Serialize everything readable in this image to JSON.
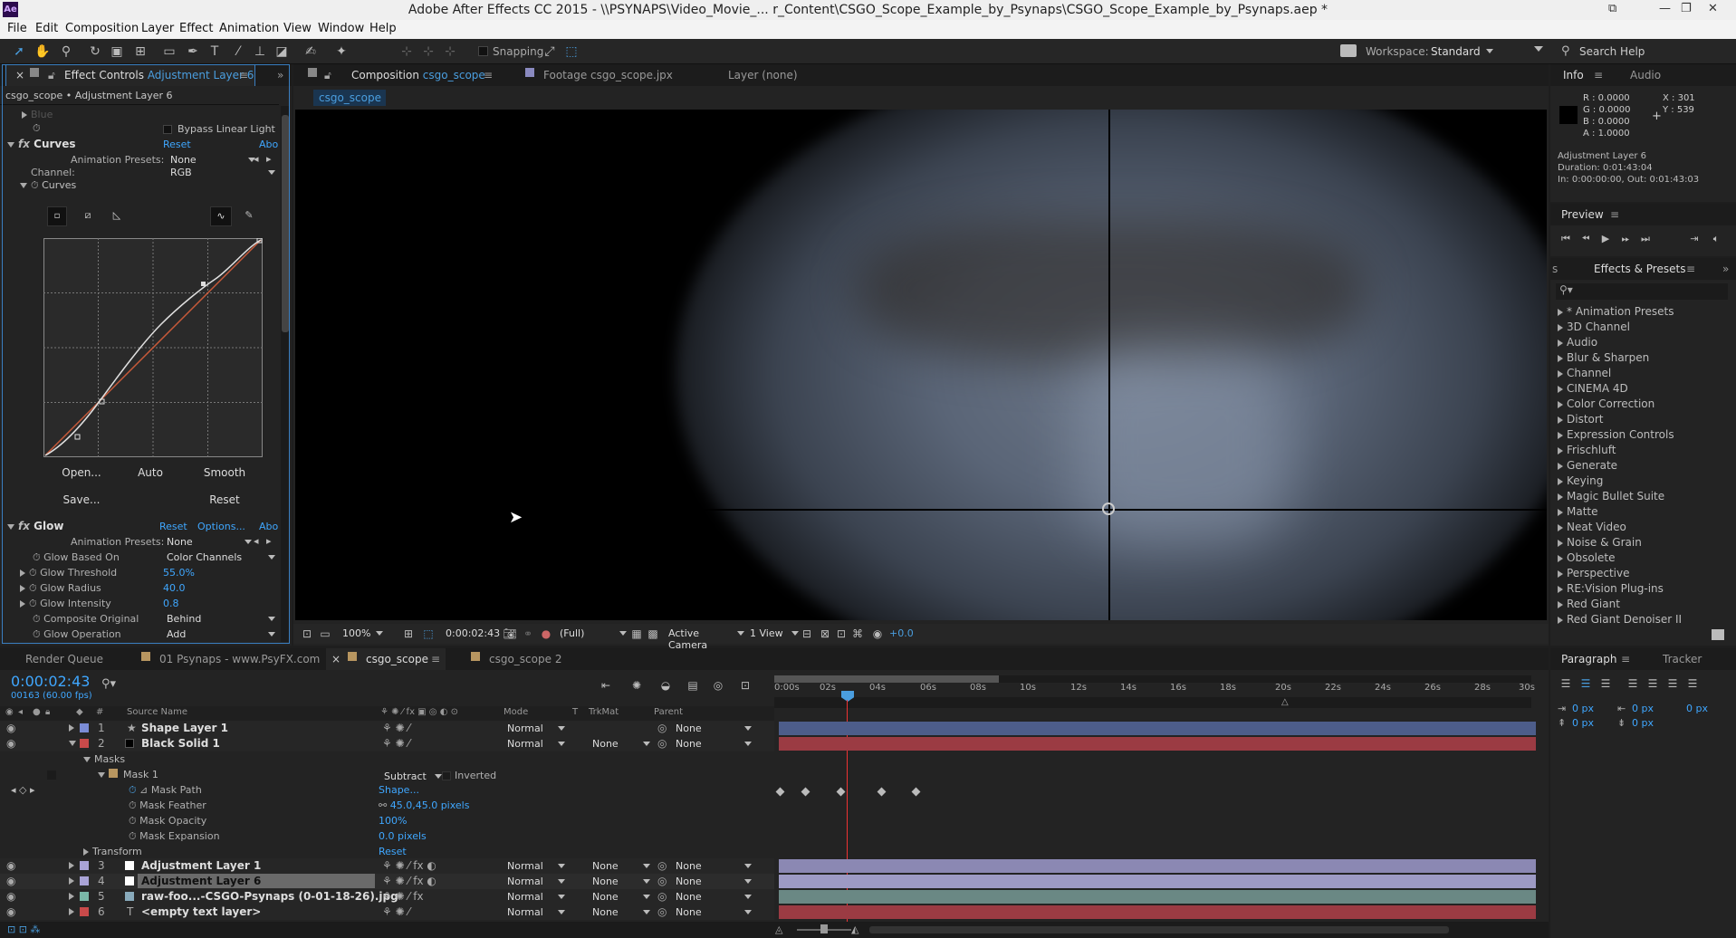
{
  "app": {
    "title": "Adobe After Effects CC 2015 - \\\\PSYNAPS\\Video_Movie_... r_Content\\CSGO_Scope_Example_by_Psynaps\\CSGO_Scope_Example_by_Psynaps.aep *",
    "logo": "Ae"
  },
  "menu": [
    "File",
    "Edit",
    "Composition",
    "Layer",
    "Effect",
    "Animation",
    "View",
    "Window",
    "Help"
  ],
  "toolbar": {
    "snapping": "Snapping",
    "workspace_label": "Workspace:",
    "workspace_value": "Standard",
    "search": "Search Help"
  },
  "effect_controls": {
    "tab_prefix": "Effect Controls",
    "tab_layer": "Adjustment Layer 6",
    "header": "csgo_scope • Adjustment Layer 6",
    "blue_row": "Blue",
    "bypass": "Bypass Linear Light",
    "curves": {
      "name": "Curves",
      "reset": "Reset",
      "about": "Abo",
      "anim_label": "Animation Presets:",
      "anim_value": "None",
      "channel_label": "Channel:",
      "channel_value": "RGB",
      "curves_label": "Curves",
      "btn_open": "Open...",
      "btn_auto": "Auto",
      "btn_smooth": "Smooth",
      "btn_save": "Save...",
      "btn_reset": "Reset"
    },
    "glow": {
      "name": "Glow",
      "reset": "Reset",
      "options": "Options...",
      "about": "Abo",
      "anim_label": "Animation Presets:",
      "anim_value": "None",
      "based_label": "Glow Based On",
      "based_value": "Color Channels",
      "threshold_label": "Glow Threshold",
      "threshold_value": "55.0%",
      "radius_label": "Glow Radius",
      "radius_value": "40.0",
      "intensity_label": "Glow Intensity",
      "intensity_value": "0.8",
      "composite_label": "Composite Original",
      "composite_value": "Behind",
      "operation_label": "Glow Operation",
      "operation_value": "Add"
    }
  },
  "composition": {
    "tab_prefix": "Composition",
    "tab_name": "csgo_scope",
    "footage_tab": "Footage csgo_scope.jpx",
    "layer_tab": "Layer (none)",
    "subtab": "csgo_scope",
    "zoom": "100%",
    "timecode": "0:00:02:43",
    "resolution": "(Full)",
    "camera": "Active Camera",
    "views": "1 View",
    "exposure": "+0.0"
  },
  "info": {
    "tab_info": "Info",
    "tab_audio": "Audio",
    "r": "R : 0.0000",
    "g": "G : 0.0000",
    "b": "B : 0.0000",
    "a": "A : 1.0000",
    "x": "X : 301",
    "y": "Y : 539",
    "layer_name": "Adjustment Layer 6",
    "duration": "Duration: 0:01:43:04",
    "inout": "In: 0:00:00:00, Out: 0:01:43:03"
  },
  "preview": {
    "title": "Preview"
  },
  "effects_presets": {
    "tab": "Effects & Presets",
    "items": [
      "* Animation Presets",
      "3D Channel",
      "Audio",
      "Blur & Sharpen",
      "Channel",
      "CINEMA 4D",
      "Color Correction",
      "Distort",
      "Expression Controls",
      "Frischluft",
      "Generate",
      "Keying",
      "Magic Bullet Suite",
      "Matte",
      "Neat Video",
      "Noise & Grain",
      "Obsolete",
      "Perspective",
      "RE:Vision Plug-ins",
      "Red Giant",
      "Red Giant Denoiser II"
    ]
  },
  "timeline": {
    "tabs": [
      "Render Queue",
      "01 Psynaps - www.PsyFX.com",
      "csgo_scope",
      "csgo_scope 2"
    ],
    "timecode": "0:00:02:43",
    "frames": "00163 (60.00 fps)",
    "columns": {
      "num": "#",
      "source": "Source Name",
      "mode": "Mode",
      "t": "T",
      "trkmat": "TrkMat",
      "parent": "Parent"
    },
    "ruler": [
      "0:00s",
      "02s",
      "04s",
      "06s",
      "08s",
      "10s",
      "12s",
      "14s",
      "16s",
      "18s",
      "20s",
      "22s",
      "24s",
      "26s",
      "28s",
      "30s"
    ],
    "layers": [
      {
        "num": "1",
        "name": "Shape Layer 1",
        "mode": "Normal",
        "trkmat": "",
        "parent": "None"
      },
      {
        "num": "2",
        "name": "Black Solid 1",
        "mode": "Normal",
        "trkmat": "None",
        "parent": "None"
      },
      {
        "num": "3",
        "name": "Adjustment Layer 1",
        "mode": "Normal",
        "trkmat": "None",
        "parent": "None"
      },
      {
        "num": "4",
        "name": "Adjustment Layer 6",
        "mode": "Normal",
        "trkmat": "None",
        "parent": "None"
      },
      {
        "num": "5",
        "name": "raw-foo...-CSGO-Psynaps (0-01-18-26).jpg",
        "mode": "Normal",
        "trkmat": "None",
        "parent": "None"
      },
      {
        "num": "6",
        "name": "<empty text layer>",
        "mode": "Normal",
        "trkmat": "None",
        "parent": "None"
      }
    ],
    "masks": "Masks",
    "mask1": "Mask 1",
    "mask_mode": "Subtract",
    "inverted": "Inverted",
    "mask_path": "Mask Path",
    "mask_path_val": "Shape...",
    "mask_feather": "Mask Feather",
    "mask_feather_val": "45.0,45.0 pixels",
    "mask_opacity": "Mask Opacity",
    "mask_opacity_val": "100%",
    "mask_expansion": "Mask Expansion",
    "mask_expansion_val": "0.0 pixels",
    "transform": "Transform",
    "transform_reset": "Reset"
  },
  "paragraph": {
    "tab": "Paragraph",
    "tracker": "Tracker",
    "px1": "0 px",
    "px2": "0 px",
    "px3": "0 px",
    "px4": "0 px",
    "px5": "0 px"
  },
  "colors": {
    "accent": "#3fa7ff",
    "shape_bar": "#4d5d8a",
    "solid_bar": "#9b3b43",
    "adj_bar": "#8b88b3",
    "img_bar": "#6a8884"
  }
}
